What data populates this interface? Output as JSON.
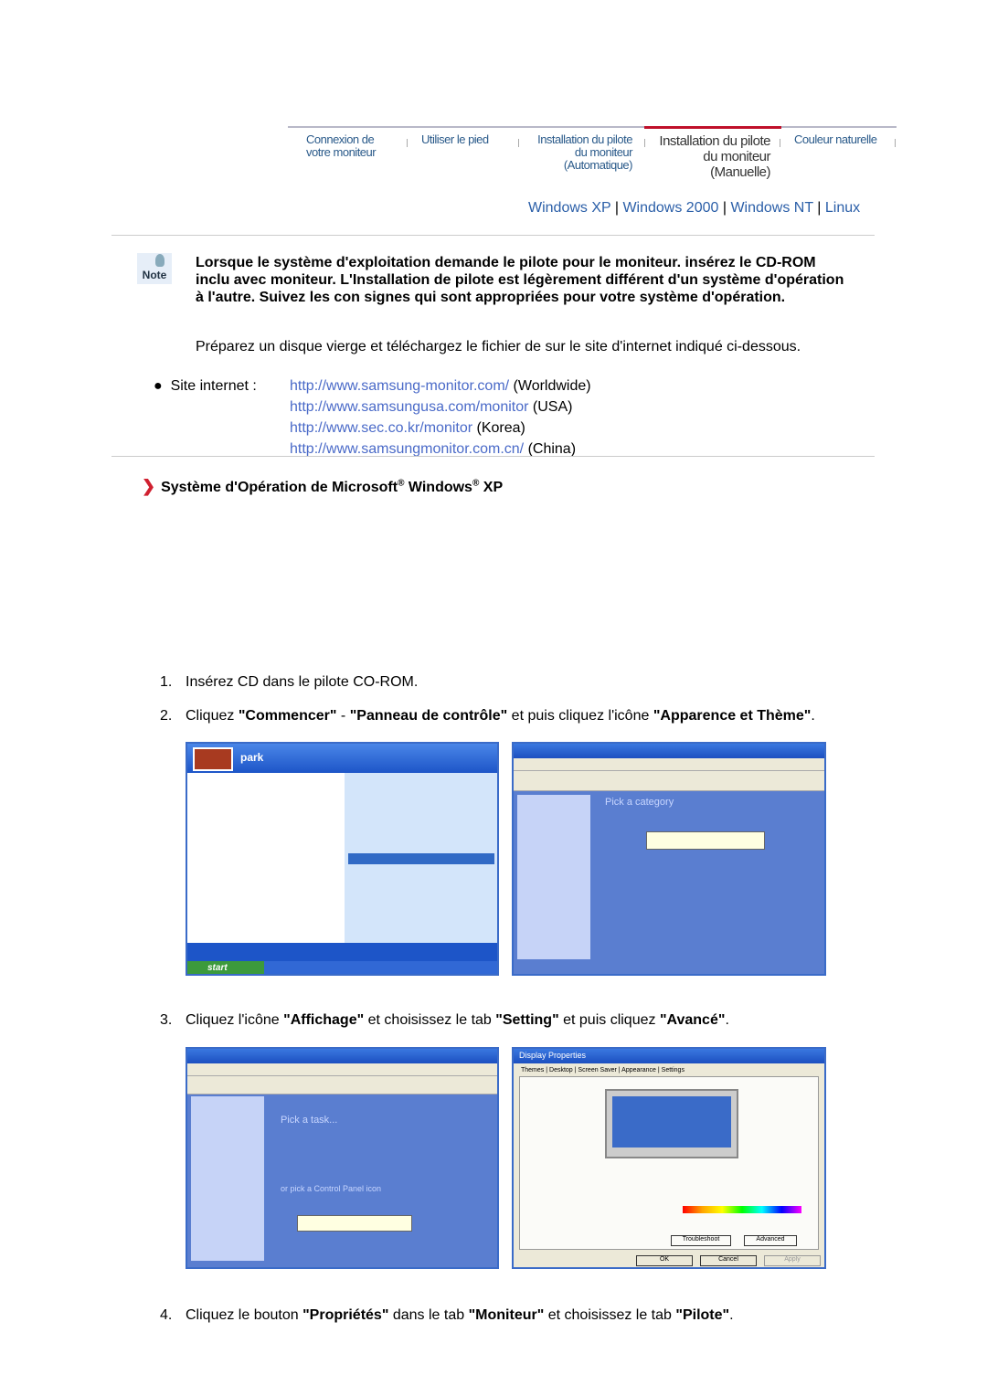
{
  "nav": {
    "items": [
      "Connexion de votre moniteur",
      "Utiliser le pied",
      "Installation du pilote du moniteur (Automatique)",
      "Installation du pilote du moniteur (Manuelle)",
      "Couleur naturelle"
    ],
    "active_index": 3,
    "active_color": "#c0102a"
  },
  "os_links": [
    "Windows XP",
    "Windows 2000",
    "Windows NT",
    "Linux"
  ],
  "note": {
    "icon_label": "Note",
    "text": "Lorsque le système d'exploitation demande le pilote pour le moniteur. insérez le CD-ROM inclu avec moniteur. L'Installation de pilote est légèrement différent d'un système d'opération à l'autre. Suivez les con signes qui sont appropriées pour votre système d'opération.",
    "prepare": "Préparez un disque vierge et téléchargez le fichier de sur le site d'internet indiqué ci-dessous."
  },
  "sites": {
    "label": "Site internet :",
    "items": [
      {
        "url": "http://www.samsung-monitor.com/",
        "region": "(Worldwide)"
      },
      {
        "url": "http://www.samsungusa.com/monitor",
        "region": "(USA)"
      },
      {
        "url": "http://www.sec.co.kr/monitor",
        "region": "(Korea)"
      },
      {
        "url": "http://www.samsungmonitor.com.cn/",
        "region": "(China)"
      }
    ]
  },
  "section": {
    "a": "Système d'Opération de Microsoft",
    "b": " Windows",
    "c": " XP",
    "reg": "®"
  },
  "steps": [
    {
      "n": "1.",
      "parts": [
        {
          "t": "Insérez CD dans le pilote CO-ROM."
        }
      ]
    },
    {
      "n": "2.",
      "parts": [
        {
          "t": "Cliquez "
        },
        {
          "t": "\"Commencer\"",
          "b": true
        },
        {
          "t": " - "
        },
        {
          "t": "\"Panneau de contrôle\"",
          "b": true
        },
        {
          "t": " et puis cliquez l'icône "
        },
        {
          "t": "\"Apparence et Thème\"",
          "b": true
        },
        {
          "t": "."
        }
      ]
    },
    {
      "n": "3.",
      "parts": [
        {
          "t": "Cliquez l'icône "
        },
        {
          "t": "\"Affichage\"",
          "b": true
        },
        {
          "t": " et choisissez le tab "
        },
        {
          "t": "\"Setting\"",
          "b": true
        },
        {
          "t": " et puis cliquez "
        },
        {
          "t": "\"Avancé\"",
          "b": true
        },
        {
          "t": "."
        }
      ]
    },
    {
      "n": "4.",
      "parts": [
        {
          "t": "Cliquez le bouton "
        },
        {
          "t": "\"Propriétés\"",
          "b": true
        },
        {
          "t": " dans le tab "
        },
        {
          "t": "\"Moniteur\"",
          "b": true
        },
        {
          "t": " et choisissez le tab "
        },
        {
          "t": "\"Pilote\"",
          "b": true
        },
        {
          "t": "."
        }
      ]
    }
  ],
  "shots": {
    "start_user": "park",
    "start_button": "start",
    "pick_category": "Pick a category",
    "pick_task": "Pick a task...",
    "pick_icon": "or pick a Control Panel icon",
    "display_title": "Display Properties",
    "display_tabs": [
      "Themes",
      "Desktop",
      "Screen Saver",
      "Appearance",
      "Settings"
    ],
    "troubleshoot": "Troubleshoot",
    "advanced": "Advanced",
    "ok": "OK",
    "cancel": "Cancel",
    "apply": "Apply"
  }
}
